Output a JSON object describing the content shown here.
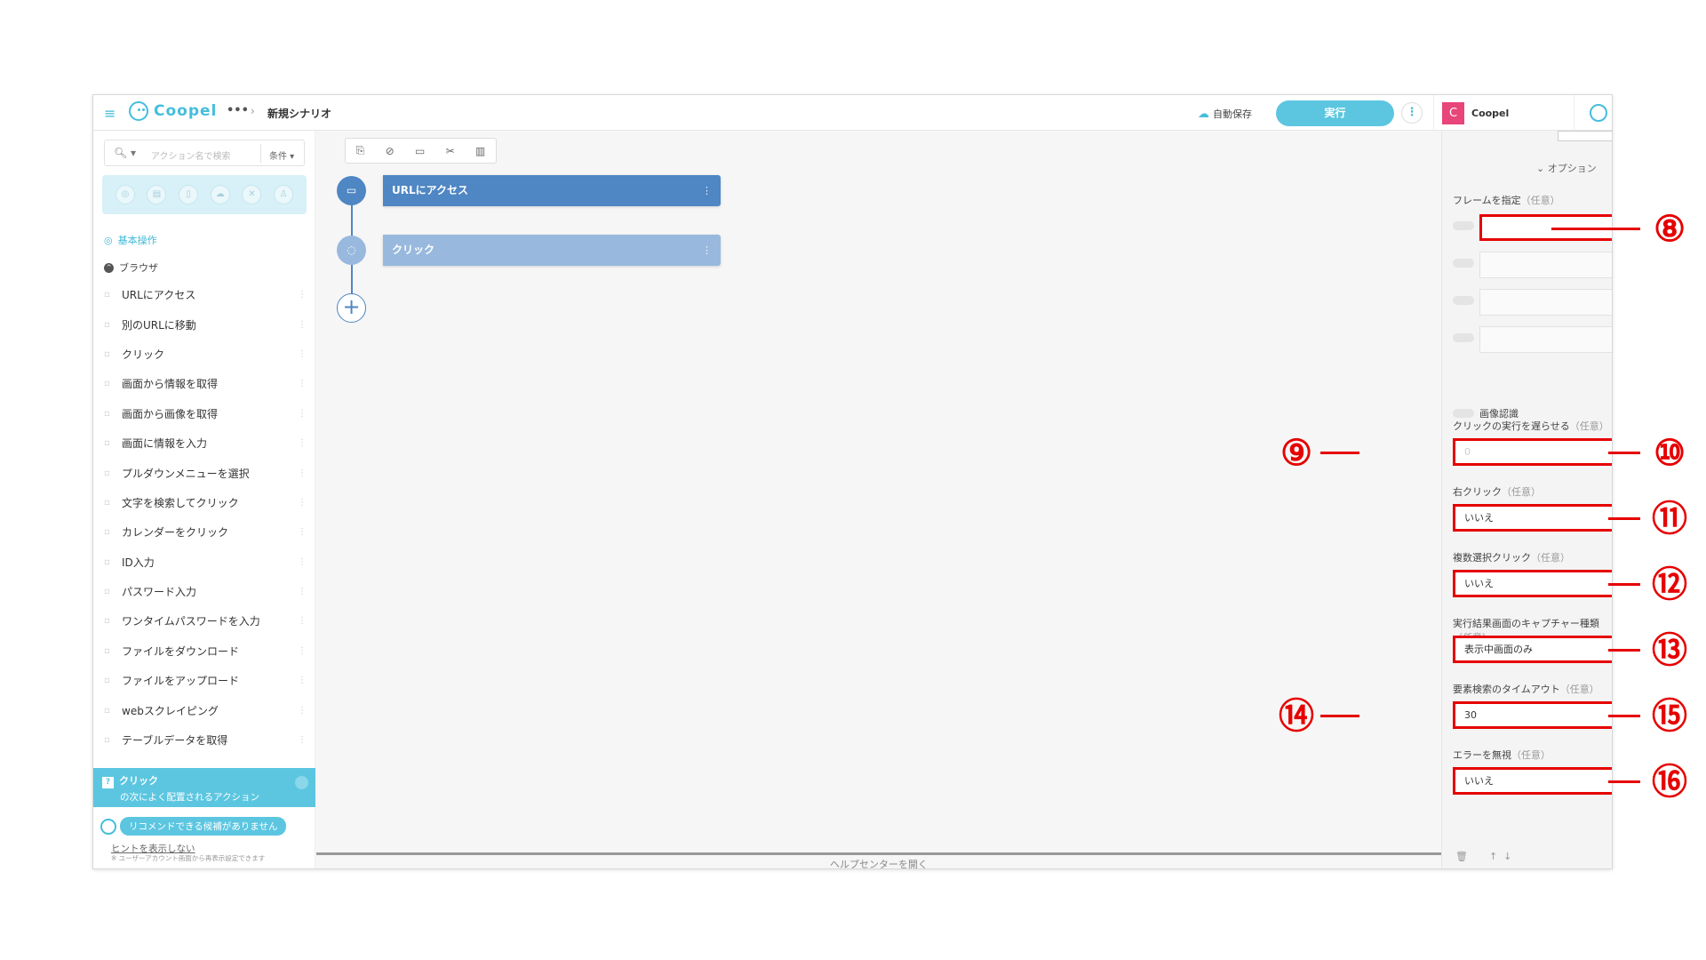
{
  "header": {
    "logo": "Coopel",
    "breadcrumb_more": "•••",
    "scenario_title": "新規シナリオ",
    "autosave": "自動保存",
    "run_button": "実行",
    "user_initial": "C",
    "user_name": "Coopel"
  },
  "left": {
    "search_placeholder": "アクション名で検索",
    "condition": "条件 ▾",
    "section": "基本操作",
    "group": "ブラウザ",
    "items": [
      "URLにアクセス",
      "別のURLに移動",
      "クリック",
      "画面から情報を取得",
      "画面から画像を取得",
      "画面に情報を入力",
      "プルダウンメニューを選択",
      "文字を検索してクリック",
      "カレンダーをクリック",
      "ID入力",
      "パスワード入力",
      "ワンタイムパスワードを入力",
      "ファイルをダウンロード",
      "ファイルをアップロード",
      "webスクレイピング",
      "テーブルデータを取得"
    ],
    "tip_title": "クリック",
    "tip_sub": "の次によく配置されるアクション",
    "bubble": "リコメンドできる候補がありません",
    "hint": "ヒントを表示しない",
    "note": "※ ユーザーアカウント画面から再表示設定できます"
  },
  "canvas": {
    "node1": "URLにアクセス",
    "node2": "クリック",
    "help": "ヘルプセンターを開く"
  },
  "right": {
    "options": "⌄ オプション",
    "frame_label": "フレームを指定",
    "optional": "（任意）",
    "image_recognition": "画像認識",
    "delay_label": "クリックの実行を遅らせる",
    "delay_value": "0",
    "right_click_label": "右クリック",
    "right_click_value": "いいえ",
    "multi_label": "複数選択クリック",
    "multi_value": "いいえ",
    "capture_label": "実行結果画面のキャプチャー種類",
    "capture_value": "表示中画面のみ",
    "timeout_label": "要素検索のタイムアウト",
    "timeout_value": "30",
    "ignore_label": "エラーを無視",
    "ignore_value": "いいえ",
    "t_button": "T"
  },
  "annotations": [
    "⑧",
    "⑨",
    "⑩",
    "⑪",
    "⑫",
    "⑬",
    "⑭",
    "⑮",
    "⑯"
  ]
}
